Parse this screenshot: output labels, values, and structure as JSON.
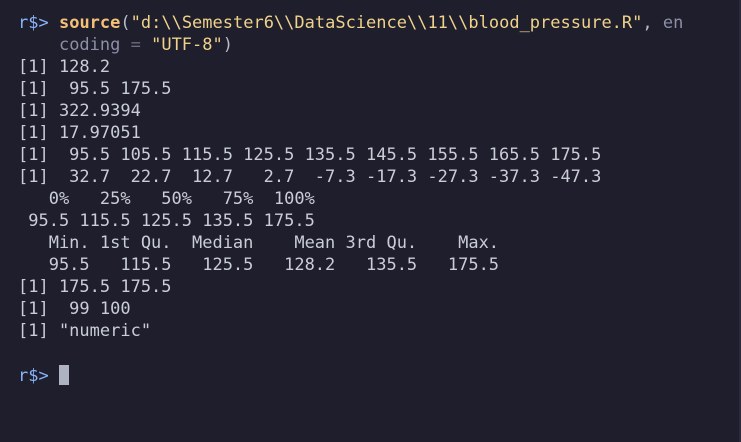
{
  "command": {
    "prompt": "r$>",
    "function": "source",
    "open_paren": "(",
    "path": "\"d:\\\\Semester6\\\\DataScience\\\\11\\\\blood_pressure.R\"",
    "comma": ", ",
    "arg_part1": "en",
    "arg_part2": "coding",
    "equals": " = ",
    "encoding_value": "\"UTF-8\"",
    "close_paren": ")"
  },
  "output": [
    "[1] 128.2",
    "[1]  95.5 175.5",
    "[1] 322.9394",
    "[1] 17.97051",
    "[1]  95.5 105.5 115.5 125.5 135.5 145.5 155.5 165.5 175.5",
    "[1]  32.7  22.7  12.7   2.7  -7.3 -17.3 -27.3 -37.3 -47.3",
    "   0%   25%   50%   75%  100% ",
    " 95.5 115.5 125.5 135.5 175.5 ",
    "   Min. 1st Qu.  Median    Mean 3rd Qu.    Max. ",
    "   95.5   115.5   125.5   128.2   135.5   175.5 ",
    "[1] 175.5 175.5",
    "[1]  99 100",
    "[1] \"numeric\""
  ],
  "input": {
    "prompt": "r$>",
    "value": ""
  },
  "colors": {
    "background": "#1e1e2c",
    "prompt": "#89b4fa",
    "function": "#f6c177",
    "string": "#f0d28a",
    "text": "#c9cdd6"
  }
}
